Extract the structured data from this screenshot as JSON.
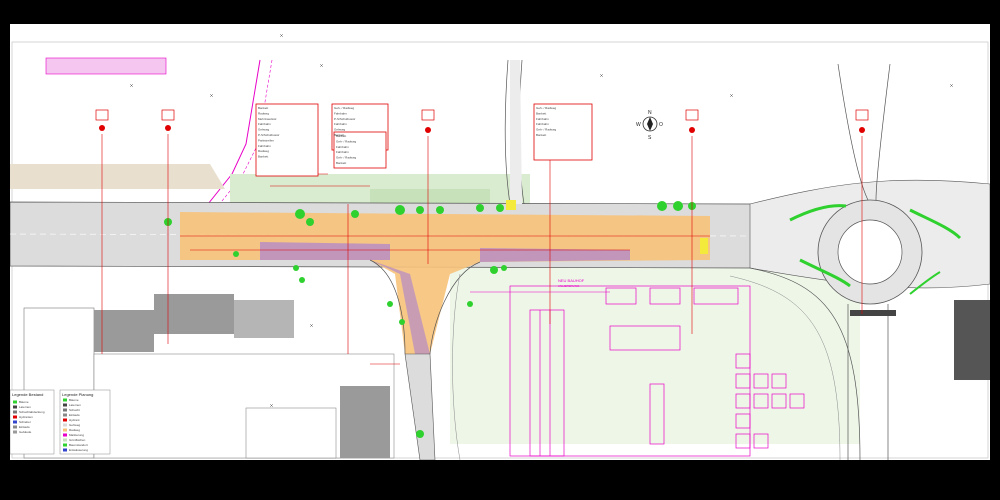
{
  "drawing": {
    "title": "",
    "colors": {
      "background": "#ffffff",
      "frame": "#000000",
      "road_asphalt": "#d9d9d9",
      "road_edge": "#555555",
      "construction_orange": "#f7c27a",
      "pink_lines": "#e800c8",
      "purple_area": "#b48ac8",
      "green_area": "#d9ecd0",
      "trees": "#2fd12f",
      "red_markers": "#e00000",
      "building_grey": "#9a9a9a",
      "yellow_marker": "#f4ea3b"
    },
    "compass": {
      "north": "N",
      "east": "O",
      "south": "S",
      "west": "W"
    },
    "sections": [
      {
        "id": "sec-1"
      },
      {
        "id": "sec-2"
      },
      {
        "id": "sec-3"
      },
      {
        "id": "sec-4"
      },
      {
        "id": "sec-5"
      },
      {
        "id": "sec-6"
      },
      {
        "id": "sec-7"
      }
    ],
    "tables": [
      {
        "rows": [
          "Bankett",
          "Radweg",
          "Mehrzweckstr.",
          "Fahrbahn",
          "Gehweg",
          "P-S/Schulbusstr",
          "Parkstreifen",
          "Fahrbahn",
          "Radweg",
          "Bankett"
        ]
      },
      {
        "rows": [
          "Geh- / Radweg",
          "Fahrbahn",
          "P-S/Schulbusstr",
          "Fahrbahn",
          "Gehweg",
          "Bankett"
        ]
      },
      {
        "rows": [
          "Bankett",
          "Geh- / Radweg",
          "Fahrbahn",
          "Fahrbahn",
          "Geh- / Radweg",
          "Bankett"
        ]
      },
      {
        "rows": [
          "Geh- / Radweg",
          "Bankett",
          "Fahrbahn",
          "Fahrbahn",
          "Geh- / Radweg",
          "Bankett"
        ]
      }
    ],
    "legend_left": {
      "title": "Legende Bestand",
      "items": [
        "Bäume",
        "Laternen",
        "Schachtabdeckung",
        "Hydranten",
        "Schieber",
        "Einlaufe",
        "Gebäude"
      ]
    },
    "legend_right": {
      "title": "Legende Planung",
      "items": [
        "Bäume",
        "Laternen",
        "Schacht",
        "Einlaufe",
        "Hydrant",
        "Gehweg",
        "Radweg",
        "Markierung",
        "Grünflächen",
        "Baumstandort",
        "Entwässerung"
      ]
    },
    "magenta_labels": [
      "NEU BAUHOF",
      "ANLIEFERUNG"
    ]
  }
}
